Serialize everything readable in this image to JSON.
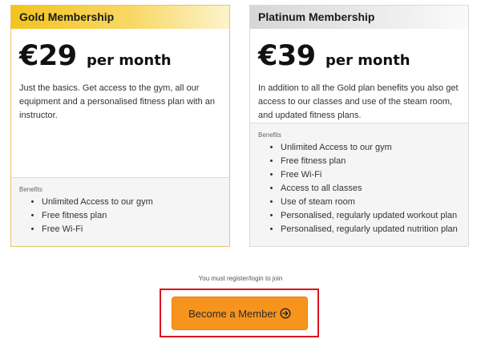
{
  "plans": [
    {
      "name": "Gold Membership",
      "price": "€29",
      "per": "per month",
      "description": "Just the basics. Get access to the gym, all our equipment and a personalised fitness plan with an instructor.",
      "benefits_label": "Benefits",
      "benefits": [
        "Unlimited Access to our gym",
        "Free fitness plan",
        "Free Wi-Fi"
      ]
    },
    {
      "name": "Platinum Membership",
      "price": "€39",
      "per": "per month",
      "description": "In addition to all the Gold plan benefits you also get access to our classes and use of the steam room, and updated fitness plans.",
      "benefits_label": "Benefits",
      "benefits": [
        "Unlimited Access to our gym",
        "Free fitness plan",
        "Free Wi-Fi",
        "Access to all classes",
        "Use of steam room",
        "Personalised, regularly updated workout plan",
        "Personalised, regularly updated nutrition plan"
      ]
    }
  ],
  "join": {
    "note": "You must register/login to join",
    "button_label": "Become a Member",
    "button_icon": "arrow-circle-right-icon"
  },
  "colors": {
    "gold": "#f3c41e",
    "platinum": "#d6d6d6",
    "button": "#f7941d",
    "highlight": "#e0101e"
  }
}
